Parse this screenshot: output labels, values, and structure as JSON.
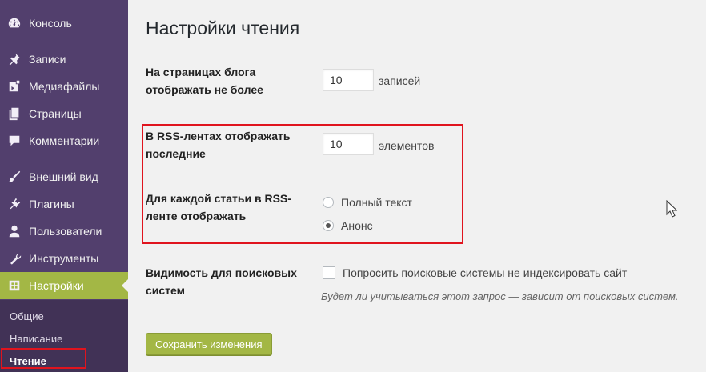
{
  "sidebar": {
    "items": [
      {
        "label": "Консоль",
        "icon": "dashboard-icon"
      },
      {
        "label": "Записи",
        "icon": "pin-icon"
      },
      {
        "label": "Медиафайлы",
        "icon": "media-icon"
      },
      {
        "label": "Страницы",
        "icon": "pages-icon"
      },
      {
        "label": "Комментарии",
        "icon": "comment-icon"
      },
      {
        "label": "Внешний вид",
        "icon": "brush-icon"
      },
      {
        "label": "Плагины",
        "icon": "plugin-icon"
      },
      {
        "label": "Пользователи",
        "icon": "user-icon"
      },
      {
        "label": "Инструменты",
        "icon": "wrench-icon"
      },
      {
        "label": "Настройки",
        "icon": "settings-icon"
      }
    ],
    "active_item": "Настройки",
    "submenu": [
      {
        "label": "Общие"
      },
      {
        "label": "Написание"
      },
      {
        "label": "Чтение"
      }
    ],
    "current_submenu": "Чтение",
    "colors": {
      "background": "#523f6d",
      "submenu_background": "#413256",
      "active": "#a3b745",
      "highlight": "#e0141e"
    }
  },
  "main": {
    "title": "Настройки чтения",
    "posts_per_page": {
      "label": "На страницах блога отображать не более",
      "value": "10",
      "unit": "записей"
    },
    "rss_posts": {
      "label": "В RSS-лентах отображать последние",
      "value": "10",
      "unit": "элементов"
    },
    "rss_content": {
      "label": "Для каждой статьи в RSS-ленте отображать",
      "options": [
        {
          "label": "Полный текст",
          "checked": false
        },
        {
          "label": "Анонс",
          "checked": true
        }
      ]
    },
    "search_visibility": {
      "label": "Видимость для поисковых систем",
      "checkbox_label": "Попросить поисковые системы не индексировать сайт",
      "checked": false,
      "hint": "Будет ли учитываться этот запрос — зависит от поисковых систем."
    },
    "save_label": "Сохранить изменения"
  }
}
